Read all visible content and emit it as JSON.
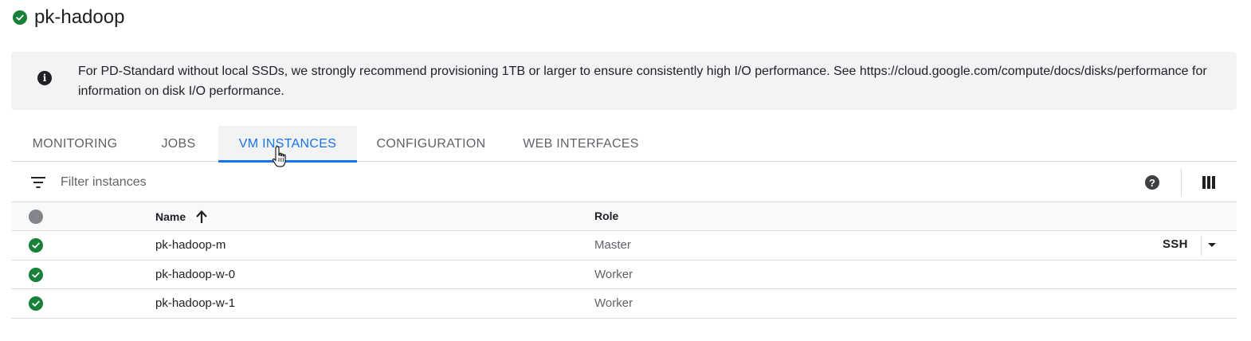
{
  "cluster": {
    "name": "pk-hadoop",
    "status_icon": "check-circle-icon",
    "status_color": "#188038"
  },
  "banner": {
    "icon": "info-icon",
    "message": "For PD-Standard without local SSDs, we strongly recommend provisioning 1TB or larger to ensure consistently high I/O performance. See https://cloud.google.com/compute/docs/disks/performance for information on disk I/O performance."
  },
  "tabs": [
    {
      "label": "MONITORING",
      "active": false
    },
    {
      "label": "JOBS",
      "active": false
    },
    {
      "label": "VM INSTANCES",
      "active": true
    },
    {
      "label": "CONFIGURATION",
      "active": false
    },
    {
      "label": "WEB INTERFACES",
      "active": false
    }
  ],
  "filter": {
    "placeholder": "Filter instances",
    "value": ""
  },
  "table": {
    "columns": {
      "name": "Name",
      "role": "Role"
    },
    "sort": {
      "column": "Name",
      "direction": "ascending"
    },
    "rows": [
      {
        "name": "pk-hadoop-m",
        "role": "Master",
        "status": "running"
      },
      {
        "name": "pk-hadoop-w-0",
        "role": "Worker",
        "status": "running"
      },
      {
        "name": "pk-hadoop-w-1",
        "role": "Worker",
        "status": "running"
      }
    ],
    "ssh_label": "SSH"
  },
  "colors": {
    "accent": "#1a73e8",
    "success": "#188038",
    "banner_bg": "#f1f3f4"
  }
}
